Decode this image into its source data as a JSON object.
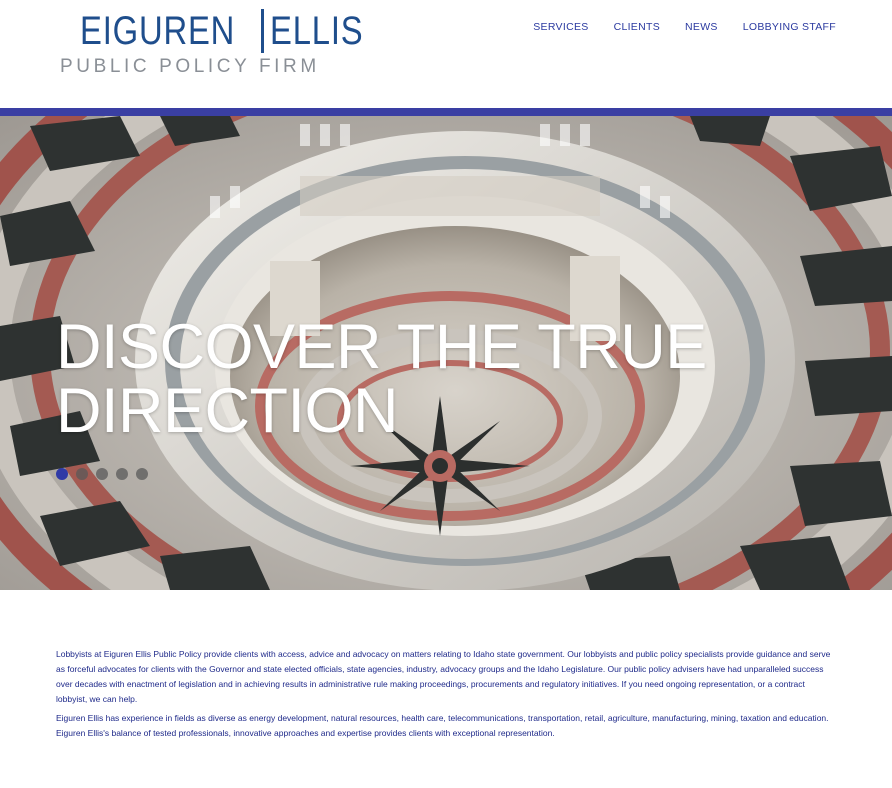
{
  "logo": {
    "name_left": "EIGUREN",
    "name_right": "ELLIS",
    "tagline": "PUBLIC POLICY FIRM"
  },
  "nav": {
    "items": [
      {
        "label": "SERVICES"
      },
      {
        "label": "CLIENTS"
      },
      {
        "label": "NEWS"
      },
      {
        "label": "LOBBYING STAFF"
      }
    ]
  },
  "hero": {
    "headline_line1": "DISCOVER THE TRUE",
    "headline_line2": "DIRECTION",
    "slide_count": 5,
    "active_slide": 1
  },
  "content": {
    "paragraph1": "Lobbyists at Eiguren Ellis Public Policy provide clients with access, advice and advocacy on matters relating to Idaho state government. Our lobbyists and public policy specialists provide guidance and serve as forceful advocates for clients with the Governor and state elected officials, state agencies, industry, advocacy groups and the Idaho Legislature.  Our public policy advisers have had unparalleled success over decades with enactment of legislation and in achieving results in administrative rule making proceedings, procurements and regulatory initiatives. If you need ongoing representation, or a contract lobbyist, we can help.",
    "paragraph2": "Eiguren Ellis has experience in fields as diverse as energy development, natural resources, health care, telecommunications, transportation, retail, agriculture, manufacturing, mining, taxation and education. Eiguren Ellis's balance of tested professionals, innovative approaches and expertise provides clients with exceptional representation."
  },
  "colors": {
    "brand_blue": "#1f4e8c",
    "accent_bar": "#3a3fa3",
    "nav_text": "#2b3aa0",
    "body_text": "#1f2a8a",
    "tagline_gray": "#8a8f96"
  }
}
